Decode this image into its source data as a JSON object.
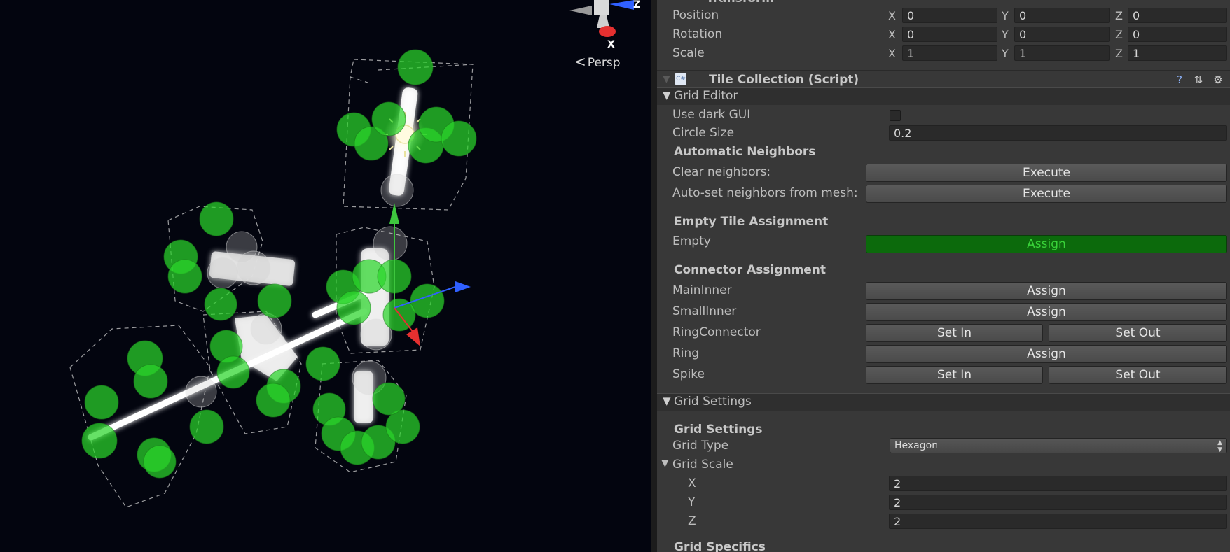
{
  "scene": {
    "view_mode_label": "Persp",
    "gizmo_axis_labels": {
      "z": "Z",
      "x": "X"
    },
    "colors": {
      "background": "#03050f",
      "neighbor_sphere": "#2bd62b",
      "axis_y": "#3ec63e",
      "axis_x": "#e53030",
      "axis_z": "#3060ff"
    },
    "icons": [
      "view-gizmo-icon",
      "light-bulb-icon",
      "move-tool-gizmo-icon"
    ]
  },
  "transform": {
    "header_cut": "Transform",
    "rows": [
      {
        "label": "Position",
        "x": "0",
        "y": "0",
        "z": "0"
      },
      {
        "label": "Rotation",
        "x": "0",
        "y": "0",
        "z": "0"
      },
      {
        "label": "Scale",
        "x": "1",
        "y": "1",
        "z": "1"
      }
    ],
    "axis_labels": {
      "x": "X",
      "y": "Y",
      "z": "Z"
    }
  },
  "component": {
    "title": "Tile Collection (Script)",
    "icons": [
      "script-cs-icon",
      "help-icon",
      "preset-icon",
      "gear-icon"
    ]
  },
  "grid_editor": {
    "section_label": "Grid Editor",
    "use_dark_gui_label": "Use dark GUI",
    "use_dark_gui_checked": false,
    "circle_size_label": "Circle Size",
    "circle_size_value": "0.2",
    "auto_neighbors_heading": "Automatic Neighbors",
    "clear_neighbors_label": "Clear neighbors:",
    "auto_set_label": "Auto-set neighbors from mesh:",
    "execute_label": "Execute",
    "empty_tile_heading": "Empty Tile Assignment",
    "empty_label": "Empty",
    "assign_label": "Assign",
    "connector_heading": "Connector Assignment",
    "connectors": [
      {
        "label": "MainInner",
        "buttons": [
          "Assign"
        ]
      },
      {
        "label": "SmallInner",
        "buttons": [
          "Assign"
        ]
      },
      {
        "label": "RingConnector",
        "buttons": [
          "Set In",
          "Set Out"
        ]
      },
      {
        "label": "Ring",
        "buttons": [
          "Assign"
        ]
      },
      {
        "label": "Spike",
        "buttons": [
          "Set In",
          "Set Out"
        ]
      }
    ],
    "assign_active_color": "#0c6a0c"
  },
  "grid_settings": {
    "section_label": "Grid Settings",
    "heading": "Grid Settings",
    "grid_type_label": "Grid Type",
    "grid_type_value": "Hexagon",
    "grid_scale_label": "Grid Scale",
    "scale": [
      {
        "label": "X",
        "value": "2"
      },
      {
        "label": "Y",
        "value": "2"
      },
      {
        "label": "Z",
        "value": "2"
      }
    ],
    "grid_specifics_heading": "Grid Specifics"
  }
}
